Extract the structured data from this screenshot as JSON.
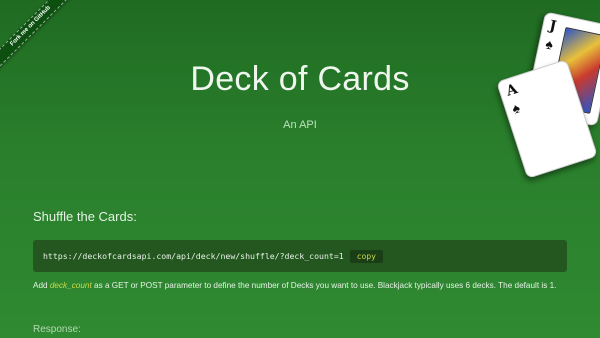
{
  "ribbon": {
    "label": "Fork me on GitHub"
  },
  "hero": {
    "title": "Deck of Cards",
    "subtitle": "An API"
  },
  "cards": {
    "back": {
      "rank": "J",
      "suit": "♠"
    },
    "front": {
      "rank": "A",
      "suit": "♠"
    }
  },
  "shuffle": {
    "title": "Shuffle the Cards:",
    "url": "https://deckofcardsapi.com/api/deck/new/shuffle/?deck_count=1",
    "copy_label": "copy",
    "desc_prefix": "Add",
    "param": "deck_count",
    "desc_suffix": "as a GET or POST parameter to define the number of Decks you want to use. Blackjack typically uses 6 decks. The default is 1."
  },
  "response": {
    "label": "Response:"
  },
  "colors": {
    "accent": "#c9d94a",
    "background": "#2a7f2c",
    "code_bg": "#23571f"
  }
}
